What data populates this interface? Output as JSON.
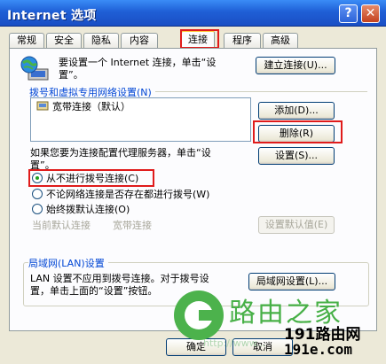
{
  "window": {
    "title": "Internet 选项",
    "help_glyph": "?",
    "close_glyph": "✕"
  },
  "tabs": [
    {
      "label": "常规"
    },
    {
      "label": "安全"
    },
    {
      "label": "隐私"
    },
    {
      "label": "内容"
    },
    {
      "label": "连接",
      "active": true
    },
    {
      "label": "程序"
    },
    {
      "label": "高级"
    }
  ],
  "setup": {
    "text_line1": "要设置一个 Internet 连接，单击“设",
    "text_line2": "置”。",
    "button": "建立连接(U)..."
  },
  "dialup": {
    "group_label": "拨号和虚拟专用网络设置(N)",
    "connections": [
      "宽带连接（默认）"
    ],
    "add_button": "添加(D)...",
    "remove_button": "删除(R)",
    "settings_button": "设置(S)...",
    "proxy_text_line1": "如果您要为连接配置代理服务器，单击“设",
    "proxy_text_line2": "置”。",
    "options": [
      {
        "label": "从不进行拨号连接(C)",
        "selected": true
      },
      {
        "label": "不论网络连接是否存在都进行拨号(W)",
        "selected": false
      },
      {
        "label": "始终拨默认连接(O)",
        "selected": false
      }
    ],
    "current_default_label": "当前默认连接",
    "current_default_value": "宽带连接",
    "set_default_button": "设置默认值(E)"
  },
  "lan": {
    "group_label": "局域网(LAN)设置",
    "text_line1": "LAN 设置不应用到拨号连接。对于拨号设",
    "text_line2": "置，单击上面的“设置”按钮。",
    "button": "局域网设置(L)..."
  },
  "footer": {
    "ok_button": "确定",
    "cancel_button": "取消"
  },
  "watermark": {
    "brand": "路由之家",
    "site_line1": "191路由网",
    "site_line2": "191e.com",
    "url": "http://www..."
  },
  "colors": {
    "titlebar": "#1f5fd6",
    "highlight": "#e01b1b",
    "group_label": "#0046d5",
    "watermark_green": "#47b047"
  }
}
